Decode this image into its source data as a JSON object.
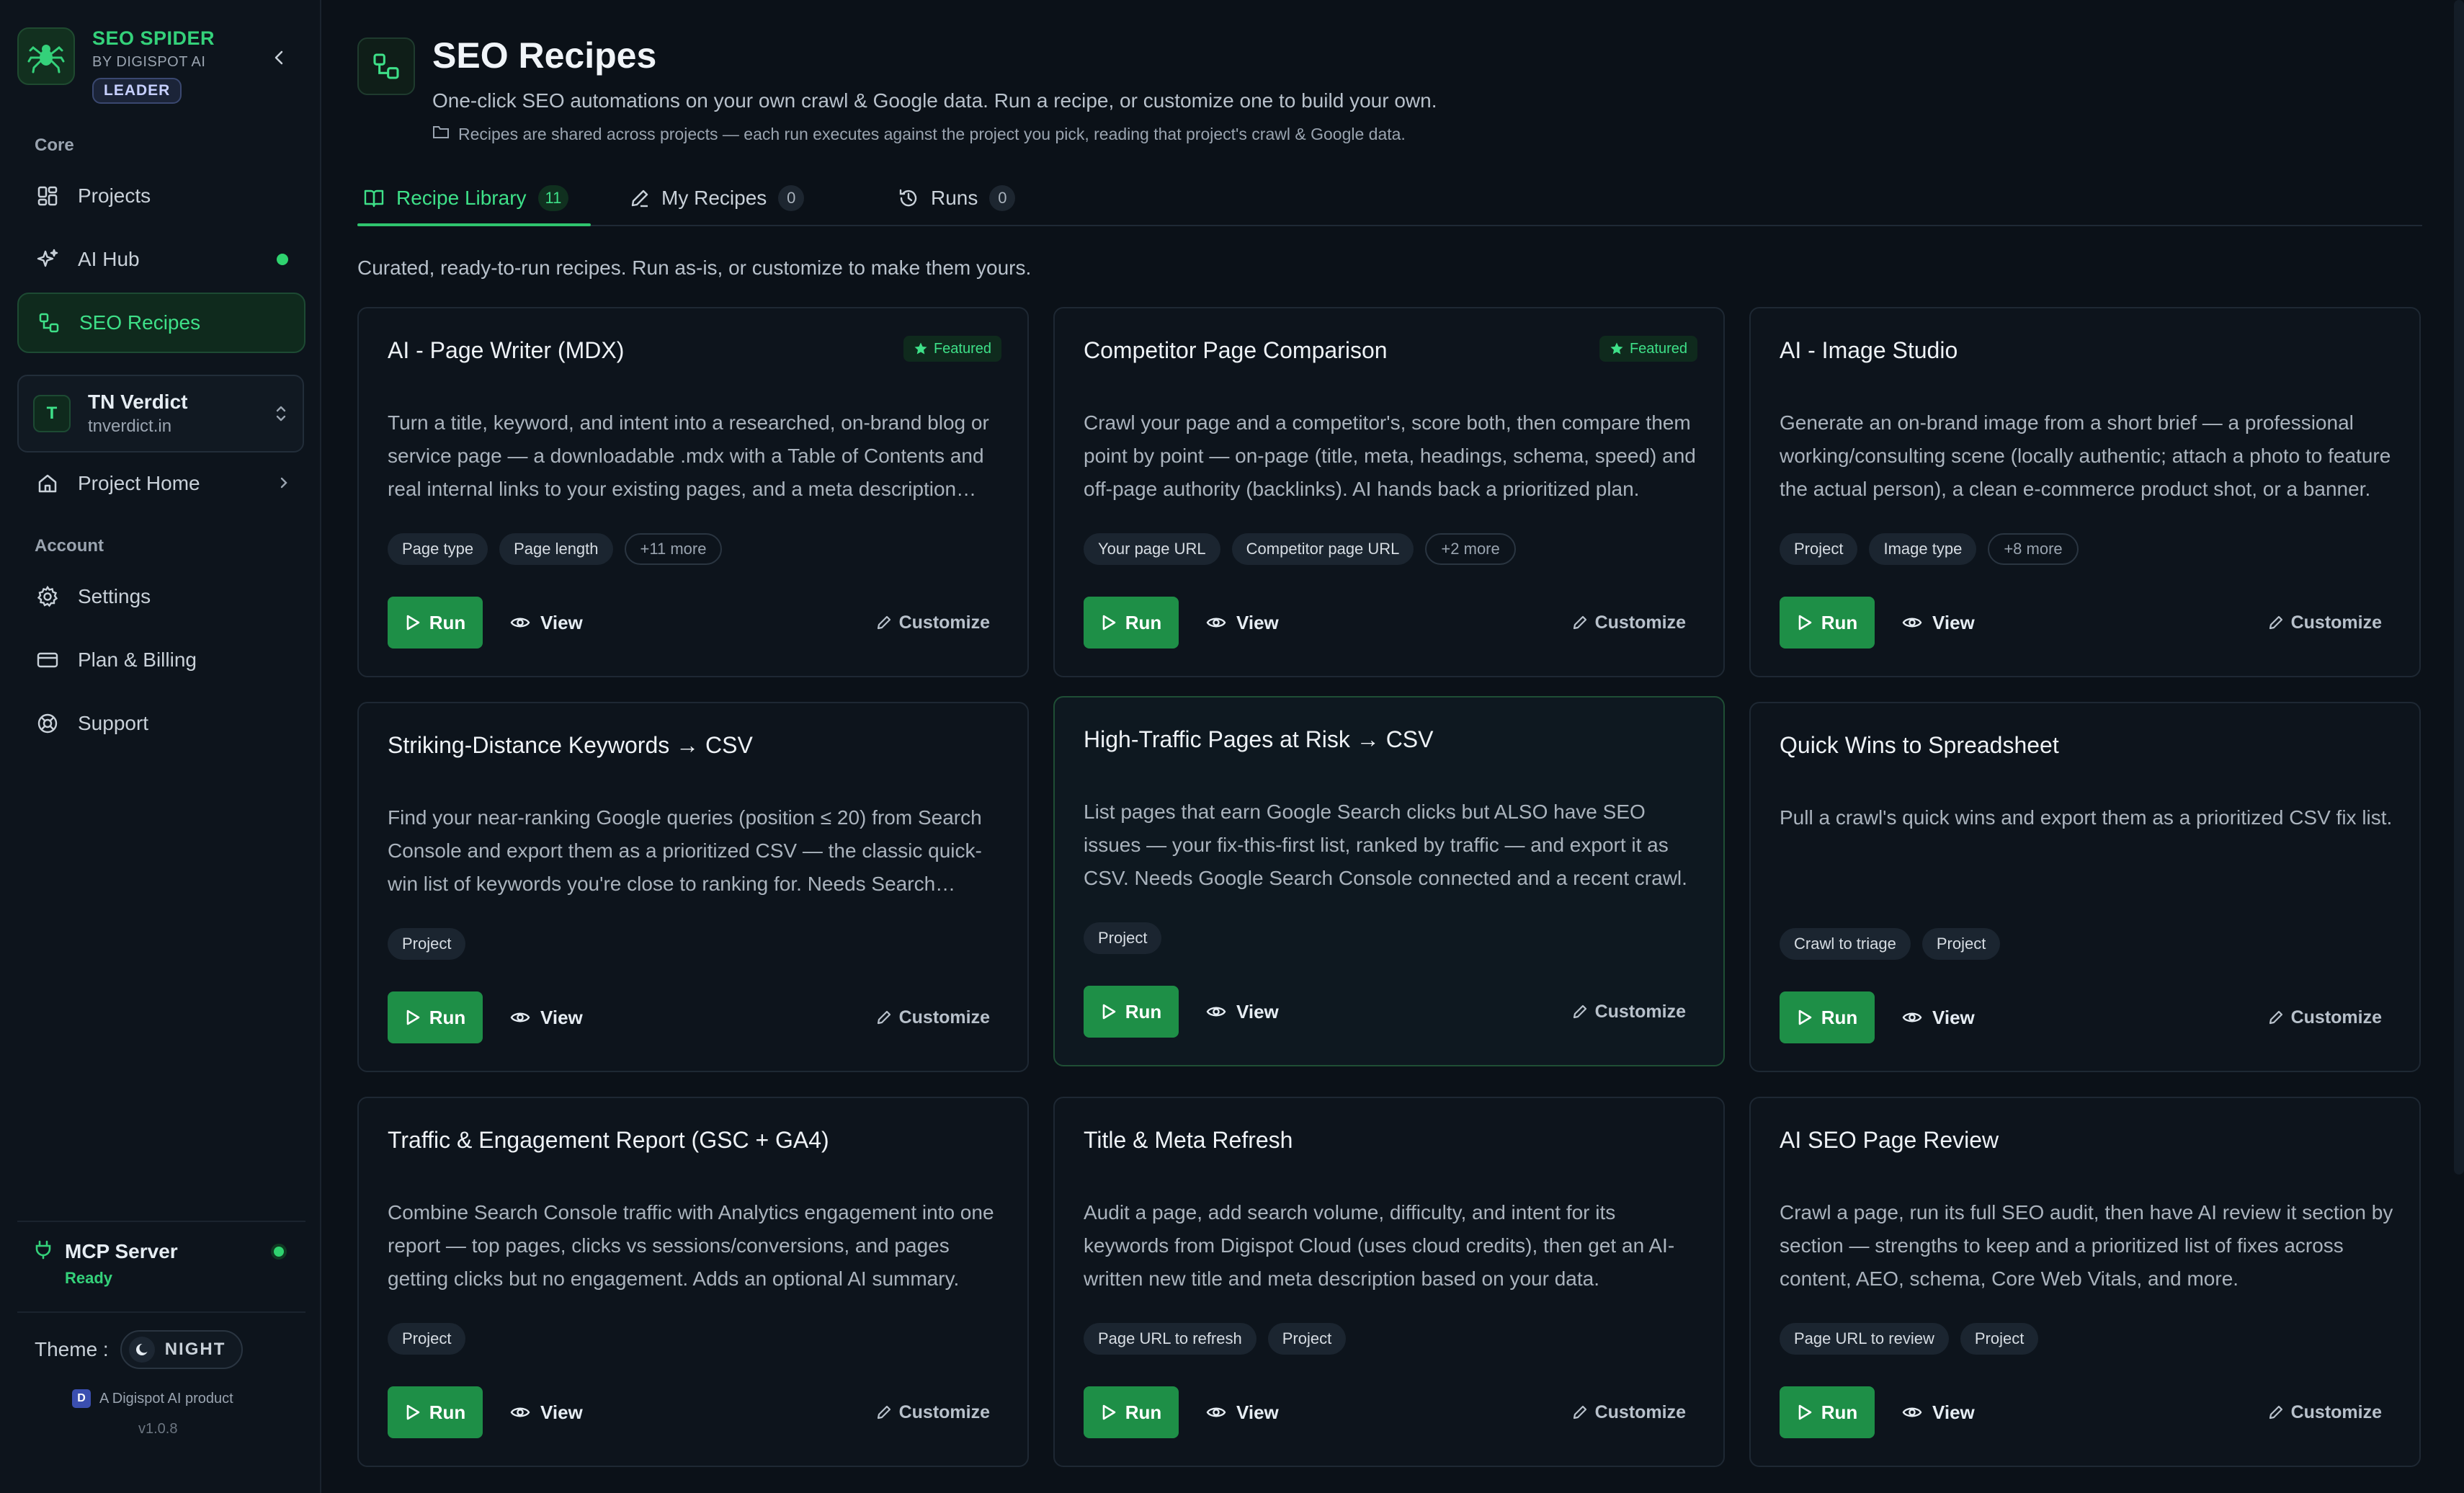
{
  "sidebar": {
    "brand_name": "SEO SPIDER",
    "brand_by": "BY DIGISPOT AI",
    "brand_badge": "LEADER",
    "section_core": "Core",
    "nav_projects": "Projects",
    "nav_ai_hub": "AI Hub",
    "nav_seo_recipes": "SEO Recipes",
    "project": {
      "avatar": "T",
      "name": "TN Verdict",
      "domain": "tnverdict.in"
    },
    "project_home": "Project Home",
    "section_account": "Account",
    "nav_settings": "Settings",
    "nav_billing": "Plan & Billing",
    "nav_support": "Support",
    "mcp_title": "MCP Server",
    "mcp_status": "Ready",
    "theme_label": "Theme :",
    "theme_value": "NIGHT",
    "product_badge": "D",
    "product_line": "A Digispot AI product",
    "version": "v1.0.8"
  },
  "header": {
    "title": "SEO Recipes",
    "subtitle": "One-click SEO automations on your own crawl & Google data. Run a recipe, or customize one to build your own.",
    "note": "Recipes are shared across projects — each run executes against the project you pick, reading that project's crawl & Google data."
  },
  "tabs": [
    {
      "label": "Recipe Library",
      "count": "11"
    },
    {
      "label": "My Recipes",
      "count": "0"
    },
    {
      "label": "Runs",
      "count": "0"
    }
  ],
  "library_desc": "Curated, ready-to-run recipes. Run as-is, or customize to make them yours.",
  "actions": {
    "run": "Run",
    "view": "View",
    "customize": "Customize",
    "featured": "Featured"
  },
  "cards": [
    {
      "title": "AI - Page Writer (MDX)",
      "featured": true,
      "desc": "Turn a title, keyword, and intent into a researched, on-brand blog or service page — a downloadable .mdx with a Table of Contents and real internal links to your existing pages, and a meta description ready to publish.",
      "tags": [
        "Page type",
        "Page length"
      ],
      "more": "+11 more"
    },
    {
      "title": "Competitor Page Comparison",
      "featured": true,
      "desc": "Crawl your page and a competitor's, score both, then compare them point by point — on-page (title, meta, headings, schema, speed) and off-page authority (backlinks). AI hands back a prioritized plan.",
      "tags": [
        "Your page URL",
        "Competitor page URL"
      ],
      "more": "+2 more"
    },
    {
      "title": "AI - Image Studio",
      "featured": false,
      "desc": "Generate an on-brand image from a short brief — a professional working/consulting scene (locally authentic; attach a photo to feature the actual person), a clean e-commerce product shot, or a banner.",
      "tags": [
        "Project",
        "Image type"
      ],
      "more": "+8 more"
    },
    {
      "title": "Striking-Distance Keywords → CSV",
      "featured": false,
      "desc": "Find your near-ranking Google queries (position ≤ 20) from Search Console and export them as a prioritized CSV — the classic quick-win list of keywords you're close to ranking for. Needs Search Console.",
      "tags": [
        "Project"
      ],
      "more": ""
    },
    {
      "title": "High-Traffic Pages at Risk → CSV",
      "featured": false,
      "desc": "List pages that earn Google Search clicks but ALSO have SEO issues — your fix-this-first list, ranked by traffic — and export it as CSV. Needs Google Search Console connected and a recent crawl.",
      "tags": [
        "Project"
      ],
      "more": ""
    },
    {
      "title": "Quick Wins to Spreadsheet",
      "featured": false,
      "desc": "Pull a crawl's quick wins and export them as a prioritized CSV fix list.",
      "tags": [
        "Crawl to triage",
        "Project"
      ],
      "more": ""
    },
    {
      "title": "Traffic & Engagement Report (GSC + GA4)",
      "featured": false,
      "desc": "Combine Search Console traffic with Analytics engagement into one report — top pages, clicks vs sessions/conversions, and pages getting clicks but no engagement. Adds an optional AI summary.",
      "tags": [
        "Project"
      ],
      "more": ""
    },
    {
      "title": "Title & Meta Refresh",
      "featured": false,
      "desc": "Audit a page, add search volume, difficulty, and intent for its keywords from Digispot Cloud (uses cloud credits), then get an AI-written new title and meta description based on your data.",
      "tags": [
        "Page URL to refresh",
        "Project"
      ],
      "more": ""
    },
    {
      "title": "AI SEO Page Review",
      "featured": false,
      "desc": "Crawl a page, run its full SEO audit, then have AI review it section by section — strengths to keep and a prioritized list of fixes across content, AEO, schema, Core Web Vitals, and more.",
      "tags": [
        "Page URL to review",
        "Project"
      ],
      "more": ""
    }
  ]
}
